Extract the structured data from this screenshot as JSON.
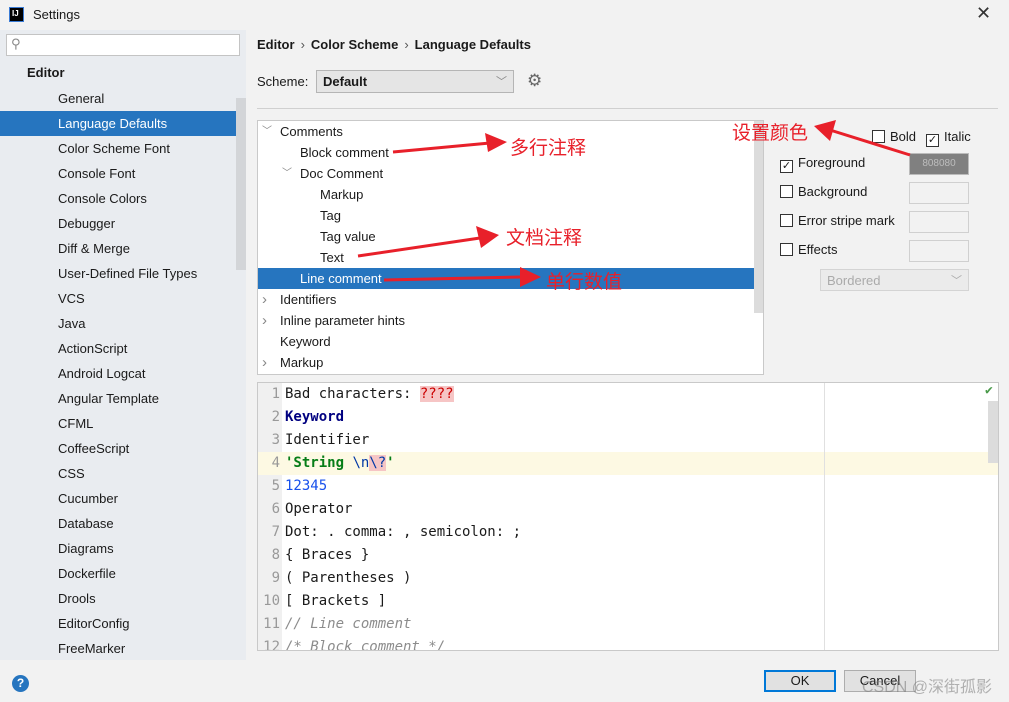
{
  "window": {
    "title": "Settings",
    "app_icon_text": "IJ",
    "close_glyph": "✕"
  },
  "sidebar": {
    "search_placeholder": "",
    "section": "Editor",
    "selected_index": 1,
    "items": [
      "General",
      "Language Defaults",
      "Color Scheme Font",
      "Console Font",
      "Console Colors",
      "Debugger",
      "Diff & Merge",
      "User-Defined File Types",
      "VCS",
      "Java",
      "ActionScript",
      "Android Logcat",
      "Angular Template",
      "CFML",
      "CoffeeScript",
      "CSS",
      "Cucumber",
      "Database",
      "Diagrams",
      "Dockerfile",
      "Drools",
      "EditorConfig",
      "FreeMarker"
    ]
  },
  "breadcrumb": [
    "Editor",
    "Color Scheme",
    "Language Defaults"
  ],
  "scheme": {
    "label": "Scheme:",
    "value": "Default"
  },
  "tree": {
    "selected_index": 7,
    "rows": [
      {
        "label": "Comments",
        "level": 0,
        "toggle": "expanded"
      },
      {
        "label": "Block comment",
        "level": 1,
        "toggle": "none"
      },
      {
        "label": "Doc Comment",
        "level": 1,
        "toggle": "expanded"
      },
      {
        "label": "Markup",
        "level": 2,
        "toggle": "none"
      },
      {
        "label": "Tag",
        "level": 2,
        "toggle": "none"
      },
      {
        "label": "Tag value",
        "level": 2,
        "toggle": "none"
      },
      {
        "label": "Text",
        "level": 2,
        "toggle": "none"
      },
      {
        "label": "Line comment",
        "level": 1,
        "toggle": "none"
      },
      {
        "label": "Identifiers",
        "level": 0,
        "toggle": "collapsed"
      },
      {
        "label": "Inline parameter hints",
        "level": 0,
        "toggle": "collapsed"
      },
      {
        "label": "Keyword",
        "level": 0,
        "toggle": "none"
      },
      {
        "label": "Markup",
        "level": 0,
        "toggle": "collapsed"
      }
    ]
  },
  "options": {
    "bold": {
      "label": "Bold",
      "checked": false
    },
    "italic": {
      "label": "Italic",
      "checked": true
    },
    "foreground": {
      "label": "Foreground",
      "checked": true,
      "color": "808080"
    },
    "background": {
      "label": "Background",
      "checked": false
    },
    "error_stripe": {
      "label": "Error stripe mark",
      "checked": false
    },
    "effects": {
      "label": "Effects",
      "checked": false
    },
    "effects_type": "Bordered"
  },
  "preview": {
    "current_line": 4,
    "lines": [
      [
        {
          "t": "Bad characters: "
        },
        {
          "t": "????",
          "s": "bad"
        }
      ],
      [
        {
          "t": "Keyword",
          "s": "kw"
        }
      ],
      [
        {
          "t": "Identifier"
        }
      ],
      [
        {
          "t": "'String ",
          "s": "str"
        },
        {
          "t": "\\n",
          "s": "esc"
        },
        {
          "t": "\\?",
          "s": "escbad"
        },
        {
          "t": "'",
          "s": "str"
        }
      ],
      [
        {
          "t": "12345",
          "s": "num5"
        }
      ],
      [
        {
          "t": "Operator"
        }
      ],
      [
        {
          "t": "Dot: . comma: , semicolon: ;"
        }
      ],
      [
        {
          "t": "{ Braces }"
        }
      ],
      [
        {
          "t": "( Parentheses )"
        }
      ],
      [
        {
          "t": "[ Brackets ]"
        }
      ],
      [
        {
          "t": "// Line comment",
          "s": "cmt"
        }
      ],
      [
        {
          "t": "/* Block comment */",
          "s": "cmt"
        }
      ]
    ]
  },
  "buttons": {
    "ok": "OK",
    "cancel": "Cancel",
    "help": "?"
  },
  "watermark": "CSDN @深街孤影",
  "annotations": {
    "block": "多行注释",
    "doc": "文档注释",
    "line": "单行数值",
    "color": "设置颜色",
    "color_hex": "#e8202a"
  }
}
